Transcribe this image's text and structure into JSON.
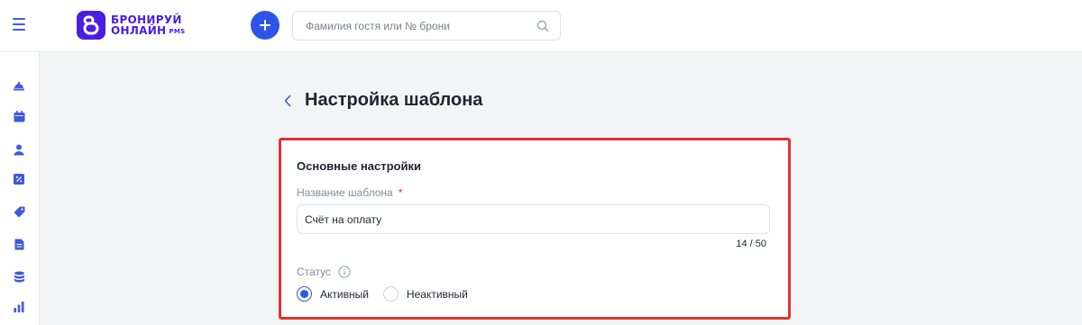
{
  "header": {
    "logo_line1": "БРОНИРУЙ",
    "logo_line2": "ОНЛАЙН",
    "logo_suffix": "PMS",
    "search": {
      "placeholder": "Фамилия гостя или № брони",
      "value": ""
    }
  },
  "sidebar": {
    "items": [
      {
        "icon": "bell-icon"
      },
      {
        "icon": "calendar-icon"
      },
      {
        "icon": "user-icon"
      },
      {
        "icon": "percent-icon"
      },
      {
        "icon": "tag-icon"
      },
      {
        "icon": "document-icon"
      },
      {
        "icon": "database-icon"
      },
      {
        "icon": "bar-chart-icon"
      }
    ]
  },
  "page": {
    "title": "Настройка шаблона"
  },
  "form": {
    "section_title": "Основные настройки",
    "name_label": "Название шаблона",
    "required_mark": "*",
    "name_value": "Счёт на оплату",
    "counter": "14 / 50",
    "status_label": "Статус",
    "status_options": [
      {
        "label": "Активный",
        "checked": true
      },
      {
        "label": "Неактивный",
        "checked": false
      }
    ]
  },
  "colors": {
    "accent": "#2f55e6",
    "brand": "#4a1fe0",
    "highlight": "#e2332f"
  }
}
